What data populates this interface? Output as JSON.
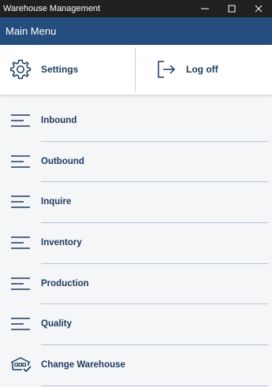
{
  "window": {
    "title": "Warehouse Management",
    "controls": [
      "minimize-icon",
      "maximize-icon",
      "close-icon"
    ]
  },
  "header": {
    "title": "Main Menu"
  },
  "top_actions": {
    "settings": {
      "label": "Settings",
      "icon": "gear-icon"
    },
    "logoff": {
      "label": "Log off",
      "icon": "logoff-icon"
    }
  },
  "menu": {
    "items": [
      {
        "label": "Inbound",
        "icon": "menu-lines-icon"
      },
      {
        "label": "Outbound",
        "icon": "menu-lines-icon"
      },
      {
        "label": "Inquire",
        "icon": "menu-lines-icon"
      },
      {
        "label": "Inventory",
        "icon": "menu-lines-icon"
      },
      {
        "label": "Production",
        "icon": "menu-lines-icon"
      },
      {
        "label": "Quality",
        "icon": "menu-lines-icon"
      },
      {
        "label": "Change Warehouse",
        "icon": "warehouse-icon"
      }
    ]
  },
  "colors": {
    "titlebar": "#202020",
    "header": "#254e7f",
    "text": "#1e3a5f",
    "background": "#f4f6f8",
    "divider": "#b7c5d6"
  }
}
